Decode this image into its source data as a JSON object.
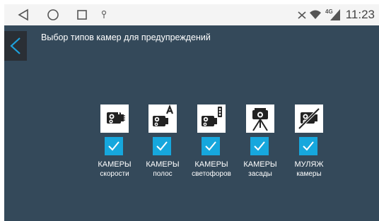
{
  "status_bar": {
    "clock": "11:23",
    "network_label": "4G",
    "icons": [
      "back-icon",
      "home-icon",
      "recent-apps-icon",
      "location-icon",
      "signal-off-icon",
      "wifi-icon",
      "cellular-4g-icon"
    ]
  },
  "header": {
    "title": "Выбор типов камер для предупреждений",
    "back_icon": "chevron-left-icon"
  },
  "cameras": [
    {
      "line1": "КАМЕРЫ",
      "line2": "скорости",
      "icon": "speed-camera-icon",
      "checked": true
    },
    {
      "line1": "КАМЕРЫ",
      "line2": "полос",
      "icon": "lane-camera-icon",
      "checked": true
    },
    {
      "line1": "КАМЕРЫ",
      "line2": "светофоров",
      "icon": "traffic-light-camera-icon",
      "checked": true
    },
    {
      "line1": "КАМЕРЫ",
      "line2": "засады",
      "icon": "ambush-camera-icon",
      "checked": true
    },
    {
      "line1": "МУЛЯЖ",
      "line2": "камеры",
      "icon": "dummy-camera-icon",
      "checked": true
    }
  ],
  "colors": {
    "background": "#34495a",
    "checkbox": "#16a7dd",
    "statusbar": "#f4f4f4"
  }
}
